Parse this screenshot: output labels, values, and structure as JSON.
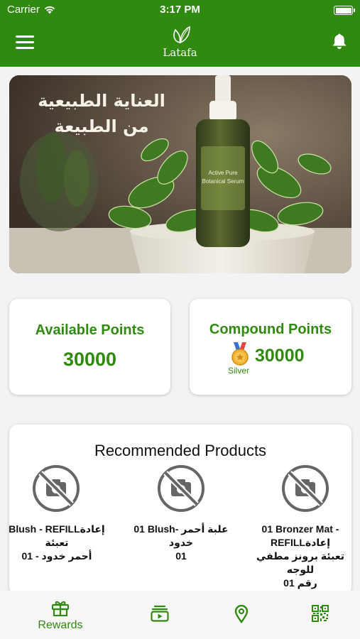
{
  "status_bar": {
    "carrier": "Carrier",
    "time": "3:17 PM"
  },
  "header": {
    "logo_text": "Latafa",
    "menu_icon": "hamburger-icon",
    "bell_icon": "bell-icon"
  },
  "banner": {
    "text_line1": "العناية الطبيعية",
    "text_line2": "من الطبيعة",
    "bottle_label_line1": "Active Pure",
    "bottle_label_line2": "Botanical Serum"
  },
  "points": {
    "available": {
      "title": "Available Points",
      "value": "30000"
    },
    "compound": {
      "title": "Compound Points",
      "value": "30000",
      "tier": "Silver",
      "tier_icon": "medal-icon"
    }
  },
  "recommended": {
    "title": "Recommended Products",
    "products": [
      {
        "line1": "Blush - REFILLإعادة",
        "line2": "تعبئة",
        "line3": "أحمر خدود - 01",
        "image_icon": "no-photo-icon"
      },
      {
        "line1": "01 Blush- علبة أحمر خدود",
        "line2": "01",
        "line3": "",
        "image_icon": "no-photo-icon"
      },
      {
        "line1": "01 Bronzer Mat -",
        "line2": "REFILLإعادة",
        "line3": "تعبئة برونز مطفي للوجه",
        "line4": "رقم 01",
        "image_icon": "no-photo-icon"
      }
    ]
  },
  "tabbar": {
    "tabs": [
      {
        "label": "Rewards",
        "icon": "gift-icon",
        "active": true
      },
      {
        "label": "",
        "icon": "video-stack-icon"
      },
      {
        "label": "",
        "icon": "location-pin-icon"
      },
      {
        "label": "",
        "icon": "qr-code-icon"
      }
    ]
  },
  "colors": {
    "primary": "#2f8a0f",
    "background": "#f3f3f3"
  }
}
